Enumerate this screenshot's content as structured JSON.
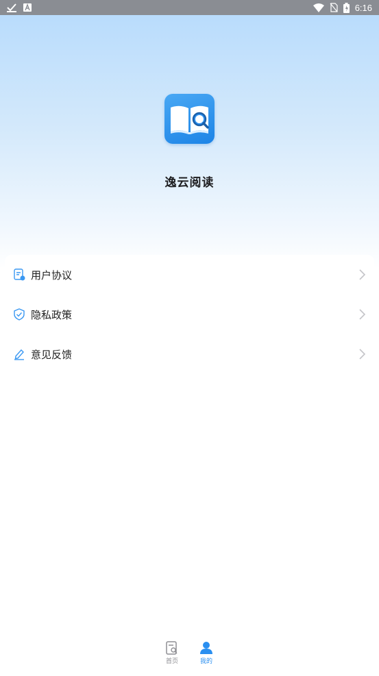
{
  "status_bar": {
    "time": "6:16",
    "left_icons": [
      "check-download-icon",
      "a-notification-icon"
    ],
    "right_icons": [
      "wifi-icon",
      "no-sim-icon",
      "battery-icon"
    ]
  },
  "app": {
    "name": "逸云阅读",
    "logo_icon": "book-magnifier-icon"
  },
  "menu": {
    "items": [
      {
        "label": "用户协议",
        "icon": "document-icon"
      },
      {
        "label": "隐私政策",
        "icon": "shield-check-icon"
      },
      {
        "label": "意见反馈",
        "icon": "edit-pen-icon"
      }
    ]
  },
  "tabbar": {
    "tabs": [
      {
        "label": "首页",
        "icon": "book-search-icon",
        "active": false
      },
      {
        "label": "我的",
        "icon": "person-icon",
        "active": true
      }
    ]
  },
  "colors": {
    "accent": "#2a8ff0",
    "status_bar": "#8a8d93",
    "hero_top": "#b9dcfc",
    "inactive_tab": "#8e8e93"
  }
}
